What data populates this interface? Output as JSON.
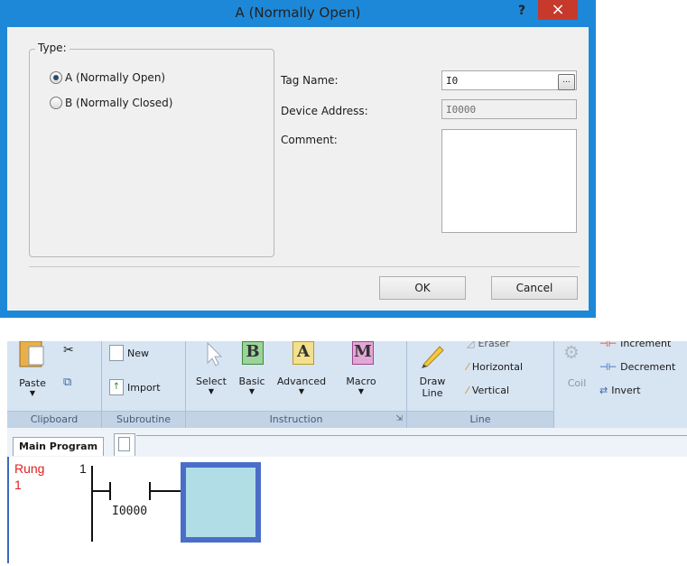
{
  "dialog": {
    "title": "A (Normally Open)",
    "help": "?",
    "close": "×",
    "type_group": {
      "legend": "Type:",
      "options": [
        {
          "label": "A (Normally Open)",
          "selected": true
        },
        {
          "label": "B (Normally Closed)",
          "selected": false
        }
      ]
    },
    "fields": {
      "tag_name_label": "Tag Name:",
      "tag_name_value": "I0",
      "browse": "...",
      "device_address_label": "Device Address:",
      "device_address_value": "I0000",
      "comment_label": "Comment:"
    },
    "buttons": {
      "ok": "OK",
      "cancel": "Cancel"
    }
  },
  "ribbon": {
    "groups": {
      "clipboard": {
        "label": "Clipboard",
        "paste": "Paste"
      },
      "subroutine": {
        "label": "Subroutine",
        "new": "New",
        "import": "Import"
      },
      "instruction": {
        "label": "Instruction",
        "select": "Select",
        "basic": "Basic",
        "advanced": "Advanced",
        "macro": "Macro",
        "basic_icon": "B",
        "advanced_icon": "A",
        "macro_icon": "M"
      },
      "line": {
        "label": "Line",
        "draw_line_1": "Draw",
        "draw_line_2": "Line",
        "eraser": "Eraser",
        "horizontal": "Horizontal",
        "vertical": "Vertical"
      },
      "misc": {
        "coil": "Coil",
        "increment": "Increment",
        "decrement": "Decrement",
        "invert": "Invert"
      }
    }
  },
  "tabs": {
    "main": "Main Program"
  },
  "ladder": {
    "rung_label": "Rung",
    "rung_number": "1",
    "rung_line": "1",
    "contact_address": "I0000",
    "colors": {
      "rung_text": "#e02020",
      "selection": "#4a6ec8",
      "selection_fill": "#b0dde6"
    }
  },
  "colors": {
    "window_border": "#1e88d8",
    "close_button": "#c7392b",
    "ribbon_bg": "#d7e4f2"
  }
}
